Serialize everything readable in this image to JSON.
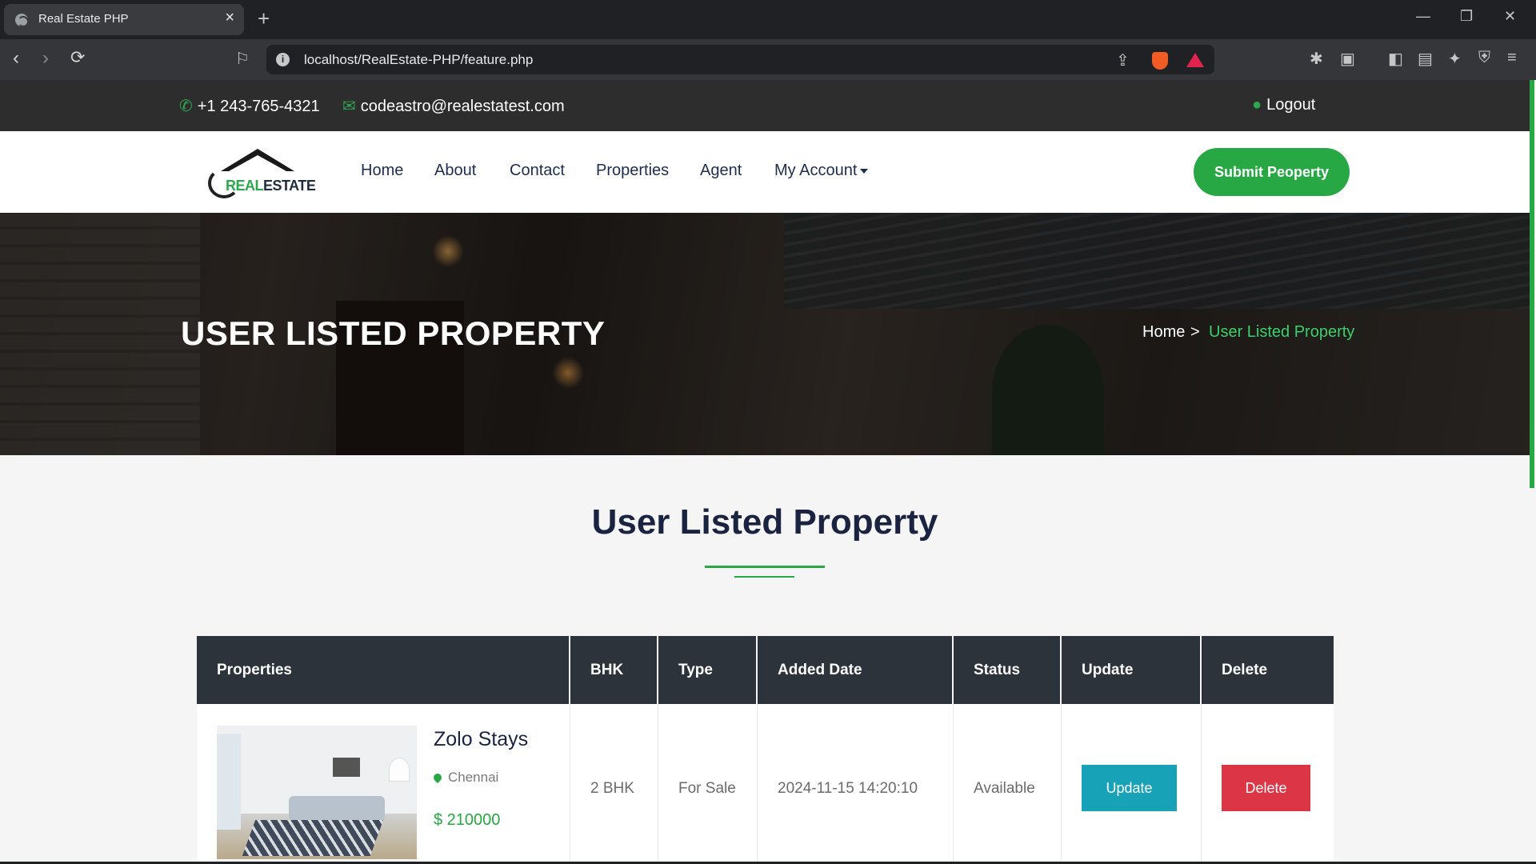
{
  "browser": {
    "tab_title": "Real Estate PHP",
    "url": "localhost/RealEstate-PHP/feature.php"
  },
  "topbar": {
    "phone": "+1 243-765-4321",
    "email": "codeastro@realestatest.com",
    "logout": "Logout"
  },
  "header": {
    "logo_real": "REAL",
    "logo_estate": "ESTATE",
    "nav": [
      "Home",
      "About",
      "Contact",
      "Properties",
      "Agent",
      "My Account"
    ],
    "submit_label": "Submit Peoperty"
  },
  "hero": {
    "title": "USER LISTED PROPERTY",
    "breadcrumb_home": "Home",
    "breadcrumb_sep": ">",
    "breadcrumb_current": "User Listed Property"
  },
  "section": {
    "title": "User Listed Property"
  },
  "table": {
    "headers": [
      "Properties",
      "BHK",
      "Type",
      "Added Date",
      "Status",
      "Update",
      "Delete"
    ],
    "rows": [
      {
        "name": "Zolo Stays",
        "location": "Chennai",
        "price": "$ 210000",
        "bhk": "2 BHK",
        "type": "For Sale",
        "added": "2024-11-15 14:20:10",
        "status": "Available",
        "update_label": "Update",
        "delete_label": "Delete"
      }
    ]
  },
  "colors": {
    "accent": "#28a745",
    "dark": "#2d333b",
    "info": "#17a2b8",
    "danger": "#dc3545"
  }
}
